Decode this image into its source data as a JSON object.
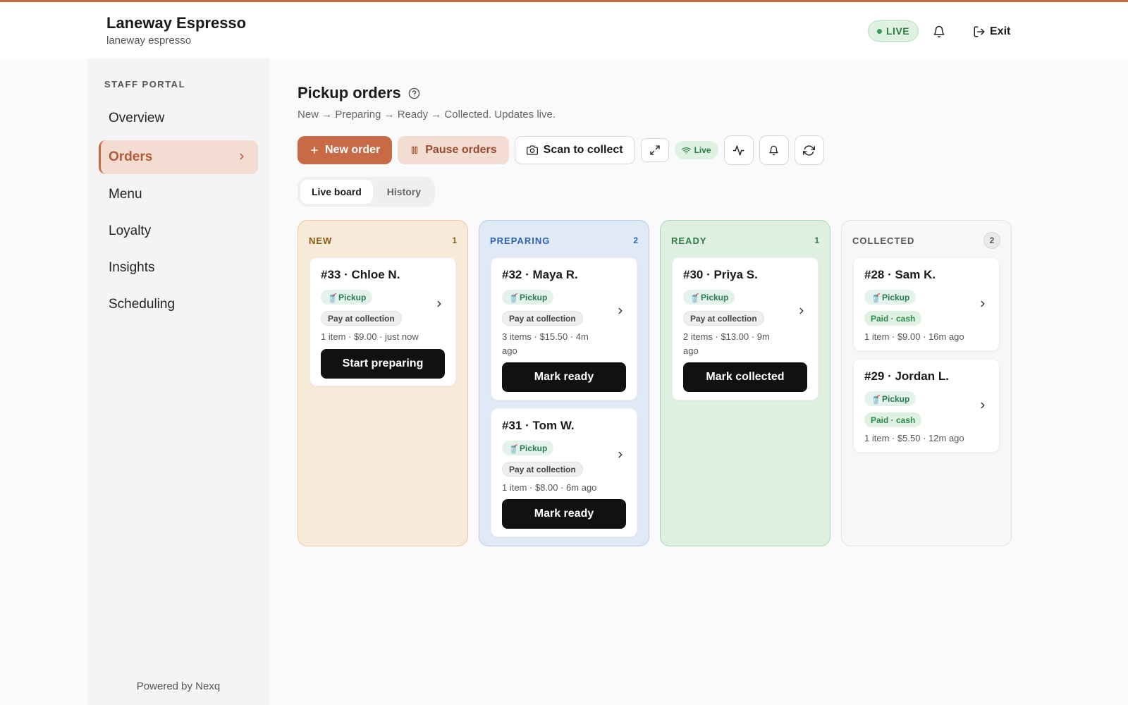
{
  "brand": {
    "title": "Laneway Espresso",
    "subtitle": "laneway espresso"
  },
  "header": {
    "live_label": "LIVE",
    "exit_label": "Exit"
  },
  "sidebar": {
    "section_label": "STAFF PORTAL",
    "items": [
      {
        "label": "Overview"
      },
      {
        "label": "Orders"
      },
      {
        "label": "Menu"
      },
      {
        "label": "Loyalty"
      },
      {
        "label": "Insights"
      },
      {
        "label": "Scheduling"
      }
    ],
    "footer": "Powered by Nexq"
  },
  "page": {
    "title": "Pickup orders",
    "subtitle": "New → Preparing → Ready → Collected. Updates live."
  },
  "toolbar": {
    "new_order": "New order",
    "pause_orders": "Pause orders",
    "scan_to_collect": "Scan to collect",
    "live_label": "Live"
  },
  "tabs": [
    {
      "label": "Live board"
    },
    {
      "label": "History"
    }
  ],
  "columns": [
    {
      "title": "NEW",
      "count": "1",
      "cards": [
        {
          "title": "#33 · Chloe N.",
          "tag": "Pickup",
          "payment": "Pay at collection",
          "meta": "1 item · $9.00 · just now",
          "action": "Start preparing"
        }
      ]
    },
    {
      "title": "PREPARING",
      "count": "2",
      "cards": [
        {
          "title": "#32 · Maya R.",
          "tag": "Pickup",
          "payment": "Pay at collection",
          "meta": "3 items · $15.50 · 4m ago",
          "action": "Mark ready"
        },
        {
          "title": "#31 · Tom W.",
          "tag": "Pickup",
          "payment": "Pay at collection",
          "meta": "1 item · $8.00 · 6m ago",
          "action": "Mark ready"
        }
      ]
    },
    {
      "title": "READY",
      "count": "1",
      "cards": [
        {
          "title": "#30 · Priya S.",
          "tag": "Pickup",
          "payment": "Pay at collection",
          "meta": "2 items · $13.00 · 9m ago",
          "action": "Mark collected"
        }
      ]
    },
    {
      "title": "COLLECTED",
      "count": "2",
      "cards": [
        {
          "title": "#28 · Sam K.",
          "tag": "Pickup",
          "payment": "Paid · cash",
          "meta": "1 item · $9.00 · 16m ago"
        },
        {
          "title": "#29 · Jordan L.",
          "tag": "Pickup",
          "payment": "Paid · cash",
          "meta": "1 item · $5.50 · 12m ago"
        }
      ]
    }
  ],
  "colors": {
    "accent": "#c96a46",
    "live_green": "#2f7d44",
    "action_black": "#111111"
  }
}
